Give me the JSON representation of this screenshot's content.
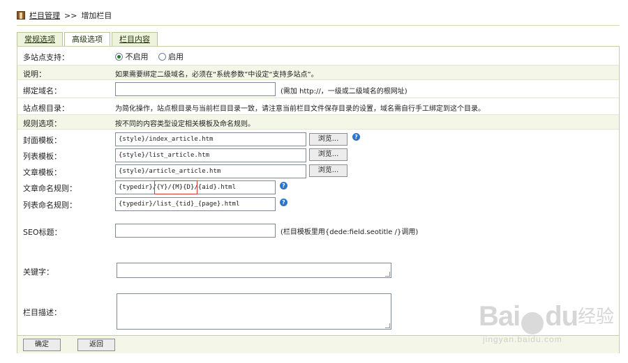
{
  "breadcrumb": {
    "section": "栏目管理",
    "separator": ">>",
    "current": "增加栏目"
  },
  "tabs": [
    {
      "label": "常规选项",
      "active": false
    },
    {
      "label": "高级选项",
      "active": true
    },
    {
      "label": "栏目内容",
      "active": false
    }
  ],
  "multisite": {
    "label": "多站点支持：",
    "options": [
      {
        "label": "不启用",
        "checked": true
      },
      {
        "label": "启用",
        "checked": false
      }
    ]
  },
  "note": {
    "label": "说明：",
    "text": "如果需要绑定二级域名，必须在“系统参数”中设定“支持多站点”。"
  },
  "bind_domain": {
    "label": "绑定域名：",
    "value": "",
    "hint": "(需加 http://，一级或二级域名的根网址)"
  },
  "site_root": {
    "label": "站点根目录：",
    "text": "为简化操作，站点根目录与当前栏目目录一致，请注意当前栏目文件保存目录的设置，域名需自行手工绑定到这个目录。"
  },
  "rules": {
    "label": "规则选项：",
    "text": "按不同的内容类型设定相关模板及命名规则。"
  },
  "cover_template": {
    "label": "封面模板：",
    "value": "{style}/index_article.htm",
    "button": "浏览..."
  },
  "list_template": {
    "label": "列表模板：",
    "value": "{style}/list_article.htm",
    "button": "浏览..."
  },
  "article_template": {
    "label": "文章模板：",
    "value": "{style}/article_article.htm",
    "button": "浏览..."
  },
  "article_naming": {
    "label": "文章命名规则：",
    "value_prefix": "{typedir}/",
    "value_highlight": "{Y}/{M}{D}/",
    "value_suffix": "{aid}.html"
  },
  "list_naming": {
    "label": "列表命名规则：",
    "value": "{typedir}/list_{tid}_{page}.html"
  },
  "seo_title": {
    "label": "SEO标题：",
    "value": "",
    "hint": "(栏目模板里用{dede:field.seotitle /}调用)"
  },
  "keywords": {
    "label": "关键字：",
    "value": ""
  },
  "description": {
    "label": "栏目描述：",
    "value": ""
  },
  "help_icon": "?",
  "actions": {
    "confirm": "确定",
    "back": "返回"
  },
  "watermark": {
    "logo_left": "Bai",
    "logo_right": "du",
    "suffix": "经验",
    "url": "jingyan.baidu.com"
  }
}
